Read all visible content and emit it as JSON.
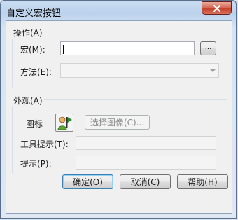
{
  "window": {
    "title": "自定义宏按钮"
  },
  "operation": {
    "group_label": "操作(A)",
    "macro_label": "宏(M):",
    "macro_value": "",
    "browse_label": "...",
    "method_label": "方法(E):",
    "method_value": ""
  },
  "appearance": {
    "group_label": "外观(A)",
    "icon_label": "图标",
    "select_image_label": "选择图像(C)...",
    "tooltip_label": "工具提示(T):",
    "tooltip_value": "",
    "hint_label": "提示(P):",
    "hint_value": ""
  },
  "buttons": {
    "ok": "确定(O)",
    "cancel": "取消(C)",
    "help": "帮助(H)"
  },
  "colors": {
    "accent": "#3c7fb1",
    "close_red": "#c4412b"
  }
}
